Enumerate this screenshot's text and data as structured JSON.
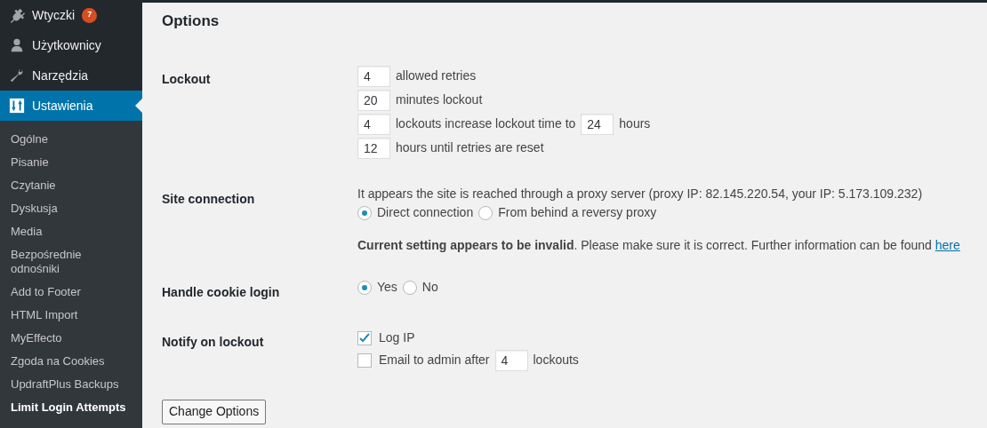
{
  "sidebar": {
    "menu": [
      {
        "label": "Wtyczki",
        "badge": "7",
        "selected": false
      },
      {
        "label": "Użytkownicy",
        "selected": false
      },
      {
        "label": "Narzędzia",
        "selected": false
      },
      {
        "label": "Ustawienia",
        "selected": true
      }
    ],
    "submenu": [
      {
        "label": "Ogólne",
        "selected": false
      },
      {
        "label": "Pisanie",
        "selected": false
      },
      {
        "label": "Czytanie",
        "selected": false
      },
      {
        "label": "Dyskusja",
        "selected": false
      },
      {
        "label": "Media",
        "selected": false
      },
      {
        "label": "Bezpośrednie odnośniki",
        "selected": false
      },
      {
        "label": "Add to Footer",
        "selected": false
      },
      {
        "label": "HTML Import",
        "selected": false
      },
      {
        "label": "MyEffecto",
        "selected": false
      },
      {
        "label": "Zgoda na Cookies",
        "selected": false
      },
      {
        "label": "UpdraftPlus Backups",
        "selected": false
      },
      {
        "label": "Limit Login Attempts",
        "selected": true
      }
    ]
  },
  "heading": "Options",
  "sections": [
    {
      "label": "Lockout",
      "rows": [
        {
          "kind": "fields",
          "parts": [
            {
              "kind": "input",
              "value": "4"
            },
            {
              "kind": "text",
              "text": "allowed retries"
            }
          ]
        },
        {
          "kind": "fields",
          "parts": [
            {
              "kind": "input",
              "value": "20"
            },
            {
              "kind": "text",
              "text": "minutes lockout"
            }
          ]
        },
        {
          "kind": "fields",
          "parts": [
            {
              "kind": "input",
              "value": "4"
            },
            {
              "kind": "text",
              "text": "lockouts increase lockout time to"
            },
            {
              "kind": "input",
              "value": "24"
            },
            {
              "kind": "text",
              "text": "hours"
            }
          ]
        },
        {
          "kind": "fields",
          "parts": [
            {
              "kind": "input",
              "value": "12"
            },
            {
              "kind": "text",
              "text": "hours until retries are reset"
            }
          ]
        }
      ]
    },
    {
      "label": "Site connection",
      "rows": [
        {
          "kind": "text",
          "text": "It appears the site is reached through a proxy server (proxy IP: 82.145.220.54, your IP: 5.173.109.232)"
        },
        {
          "kind": "radios",
          "options": [
            {
              "label": "Direct connection",
              "selected": true
            },
            {
              "label": "From behind a reversy proxy",
              "selected": false
            }
          ]
        },
        {
          "kind": "warning",
          "text": "**Current setting appears to be invalid**. Please make sure it is correct. Further information can be found ",
          "link": "here"
        }
      ]
    },
    {
      "label": "Handle cookie login",
      "rows": [
        {
          "kind": "radios",
          "options": [
            {
              "label": "Yes",
              "selected": true
            },
            {
              "label": "No",
              "selected": false
            }
          ]
        }
      ]
    },
    {
      "label": "Notify on lockout",
      "rows": [
        {
          "kind": "checkbox",
          "checked": true,
          "parts": [
            {
              "kind": "text",
              "text": "Log IP"
            }
          ]
        },
        {
          "kind": "checkbox",
          "checked": false,
          "parts": [
            {
              "kind": "text",
              "text": "Email to admin after"
            },
            {
              "kind": "input",
              "value": "4"
            },
            {
              "kind": "text",
              "text": "lockouts"
            }
          ]
        }
      ]
    }
  ],
  "button": "Change Options"
}
